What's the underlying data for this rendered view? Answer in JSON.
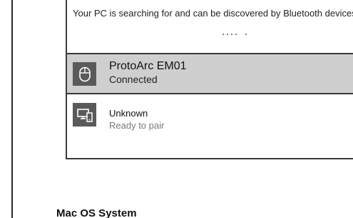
{
  "bluetooth_panel": {
    "status_text": "Your PC is searching for and can be discovered by Bluetooth devices.",
    "devices": [
      {
        "name": "ProtoArc EM01",
        "status": "Connected",
        "icon": "mouse-icon",
        "selected": true
      },
      {
        "name": "Unknown",
        "status": "Ready to pair",
        "icon": "computer-phone-icon",
        "selected": false
      }
    ]
  },
  "document": {
    "section_heading": "Mac OS System"
  },
  "colors": {
    "selected_row": "#cfcfcf",
    "icon_tile": "#5a5a5a",
    "muted_text": "#7a7a7a"
  }
}
